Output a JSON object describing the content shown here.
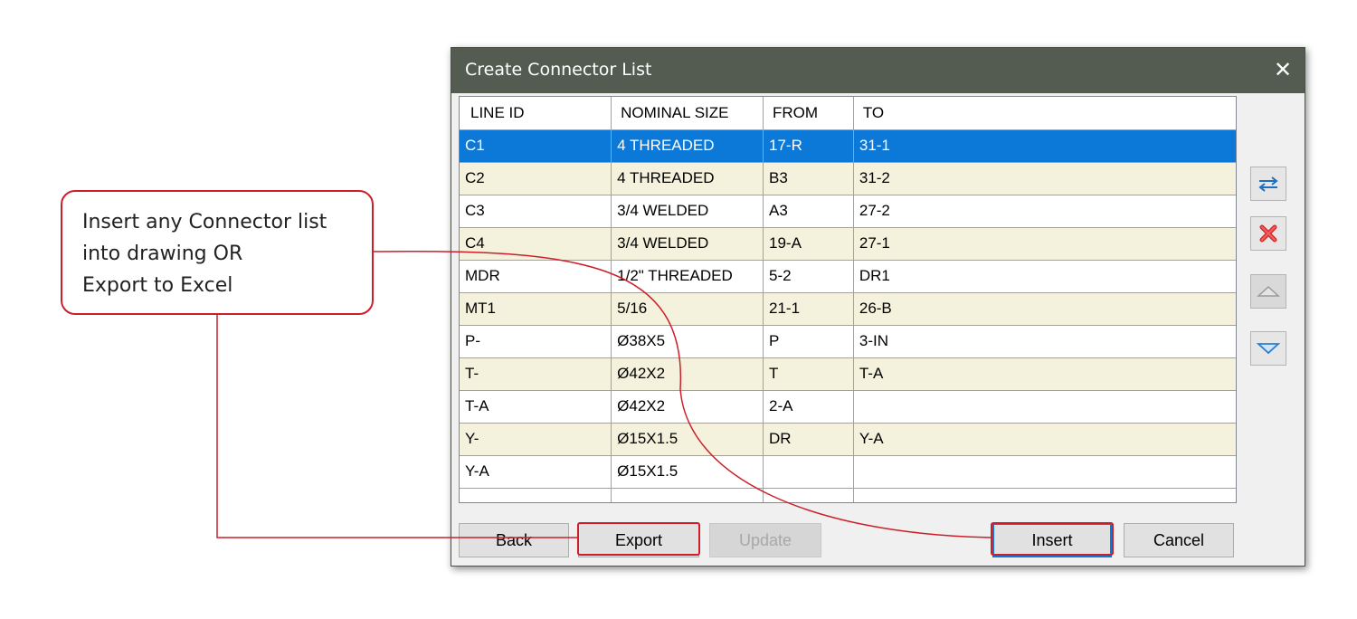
{
  "dialog": {
    "title": "Create Connector List",
    "close_label": "✕"
  },
  "grid": {
    "columns": [
      "LINE ID",
      "NOMINAL SIZE",
      "FROM",
      "TO"
    ],
    "rows": [
      {
        "line_id": "C1",
        "nominal_size": "4 THREADED",
        "from": "17-R",
        "to": "31-1",
        "selected": true
      },
      {
        "line_id": "C2",
        "nominal_size": "4 THREADED",
        "from": "B3",
        "to": "31-2"
      },
      {
        "line_id": "C3",
        "nominal_size": "3/4 WELDED",
        "from": "A3",
        "to": "27-2"
      },
      {
        "line_id": "C4",
        "nominal_size": "3/4 WELDED",
        "from": "19-A",
        "to": "27-1"
      },
      {
        "line_id": "MDR",
        "nominal_size": "1/2\" THREADED",
        "from": "5-2",
        "to": "DR1"
      },
      {
        "line_id": "MT1",
        "nominal_size": "5/16",
        "from": "21-1",
        "to": "26-B"
      },
      {
        "line_id": "P-",
        "nominal_size": "Ø38X5",
        "from": "P",
        "to": "3-IN"
      },
      {
        "line_id": "T-",
        "nominal_size": "Ø42X2",
        "from": "T",
        "to": "T-A"
      },
      {
        "line_id": "T-A",
        "nominal_size": "Ø42X2",
        "from": "2-A",
        "to": ""
      },
      {
        "line_id": "Y-",
        "nominal_size": "Ø15X1.5",
        "from": "DR",
        "to": "Y-A"
      },
      {
        "line_id": "Y-A",
        "nominal_size": "Ø15X1.5",
        "from": "",
        "to": ""
      }
    ]
  },
  "side_buttons": {
    "swap_icon": "swap-arrows-icon",
    "delete_icon": "red-x-icon",
    "up_icon": "triangle-up-icon",
    "down_icon": "triangle-down-icon"
  },
  "buttons": {
    "back": "Back",
    "export": "Export",
    "update": "Update",
    "insert": "Insert",
    "cancel": "Cancel"
  },
  "annotation": {
    "lines": [
      "Insert any Connector list",
      "into drawing OR",
      "Export to Excel"
    ]
  },
  "colors": {
    "title_bar": "#545c52",
    "selection": "#0c78d7",
    "alt_row": "#f4f2dc",
    "annotation_red": "#cc1f2a"
  }
}
